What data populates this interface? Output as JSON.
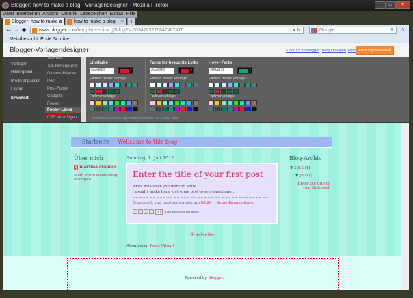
{
  "window": {
    "title": "Blogger: how to make a blog - Vorlagendesigner - Mozilla Firefox"
  },
  "menu": [
    "Datei",
    "Bearbeiten",
    "Ansicht",
    "Chronik",
    "Lesezeichen",
    "Extras",
    "Hilfe"
  ],
  "tabs": [
    {
      "label": "Blogger: how to make a blog..."
    },
    {
      "label": "how to make a blog"
    }
  ],
  "address": {
    "domain": "www.blogger.com",
    "path": "/template-editor.g?blogID=5034223276847467476"
  },
  "search": {
    "placeholder": "Google"
  },
  "bookmarks": [
    "Meistbesucht",
    "Erste Schritte"
  ],
  "header": {
    "title": "Blogger-Vorlagendesigner",
    "back": "« Zurück zu Blogger",
    "view": "Blog anzeigen",
    "help": "Hilfe",
    "apply": "Auf Blog anwenden"
  },
  "nav": [
    "Vorlagen",
    "Hintergrund",
    "Breite anpassen",
    "Layout",
    "Erweitert"
  ],
  "subnav": [
    "Tab-Text",
    "Tab-Hintergrund",
    "Datums-Header",
    "Post",
    "Post-Footer",
    "Gadgets",
    "Footer",
    "Footer-Links",
    "CSS hinzufügen"
  ],
  "colors": [
    {
      "label": "Linkfarbe",
      "hex": "#ee0f32",
      "swatch": "#ee0f32"
    },
    {
      "label": "Farbe für besuchte Links",
      "hex": "#ee0f32",
      "swatch": "#ee0f32"
    },
    {
      "label": "Hover-Farbe",
      "hex": "#00a976",
      "swatch": "#00a976"
    }
  ],
  "template_colors_label": "Farben dieser Vorlage",
  "suggestions_label": "Farbvorschläge",
  "template_colors": [
    "#ffffff",
    "#c8fff8",
    "#e0e0ff",
    "#88aaff",
    "#22eedd",
    "#666666",
    "#00a976",
    "#557799",
    "#226644",
    "#ee0f32",
    "#333333",
    "#116633",
    "#006666"
  ],
  "suggestions": [
    "#ffcccc",
    "#ffcc00",
    "#77eedd",
    "#66ddcc",
    "#22ee00",
    "#00eecc",
    "#6699ff",
    "#997755",
    "#557777",
    "#444444",
    "#007766",
    "#009999",
    "#cc00cc",
    "#ee0f32",
    "#0022ff",
    "#111111"
  ],
  "reset_link": "Erweiterte Änderungen zurücksetzen auf footer-links",
  "blog": {
    "nav_home": "Startseite",
    "nav_welcome": "Wellcome to this blog",
    "about_title": "Über mich",
    "author": "martina staniek",
    "profile_link": "Mein Profil vollständig anzeigen",
    "date": "Sonntag, 1. Juli 2012",
    "post_title": "Enter the title of your first post",
    "post_body1": "write whatever you want to write ....",
    "post_body2": "i usually make here just some text to see something :)",
    "posted_by": "Eingestellt von martina staniek um",
    "time": "09:28",
    "comments": "Keine Kommentare:",
    "plus_label": "+1",
    "recommend": "Dies auf Google empfehlen",
    "archive_title": "Blog-Archiv",
    "year": "2012",
    "year_count": "(1)",
    "month": "Juli",
    "month_count": "(1)",
    "archive_post": "Enter the title of your first post",
    "home_link": "Startseite",
    "subscribe": "Abonnieren",
    "feed": "Posts (Atom)",
    "powered": "Powered by",
    "blogger": "Blogger"
  }
}
